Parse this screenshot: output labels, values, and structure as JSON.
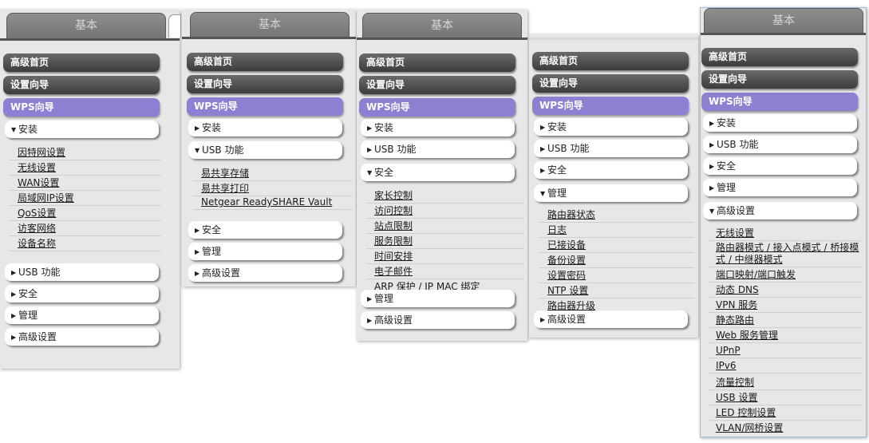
{
  "tab_label": "基本",
  "top_items": {
    "advanced_home": "高级首页",
    "setup_wizard": "设置向导",
    "wps_wizard": "WPS向导"
  },
  "sections": {
    "install": "安装",
    "usb": "USB 功能",
    "security": "安全",
    "management": "管理",
    "advanced": "高级设置"
  },
  "arrows": {
    "collapsed": "▶",
    "expanded": "▼"
  },
  "install_items": [
    "因特网设置",
    "无线设置",
    "WAN设置",
    "局域网IP设置",
    "QoS设置",
    "访客网络",
    "设备名称"
  ],
  "usb_items": [
    "易共享存储",
    "易共享打印",
    "Netgear ReadySHARE Vault"
  ],
  "security_items": [
    "家长控制",
    "访问控制",
    "站点限制",
    "服务限制",
    "时间安排",
    "电子邮件",
    "ARP 保护 / IP MAC 绑定"
  ],
  "management_items": [
    "路由器状态",
    "日志",
    "已接设备",
    "备份设置",
    "设置密码",
    "NTP 设置",
    "路由器升级"
  ],
  "advanced_items": [
    "无线设置",
    "路由器模式 / 接入点模式 / 桥接模式 / 中继器模式",
    "端口映射/端口触发",
    "动态 DNS",
    "VPN 服务",
    "静态路由",
    "Web 服务管理",
    "UPnP",
    "IPv6",
    "流量控制",
    "USB 设置",
    "LED 控制设置",
    "VLAN/网桥设置"
  ],
  "colors": {
    "wps": "#8b80d2",
    "dark_bar": "#4a4a4a",
    "panel": "#e7e7e7"
  }
}
